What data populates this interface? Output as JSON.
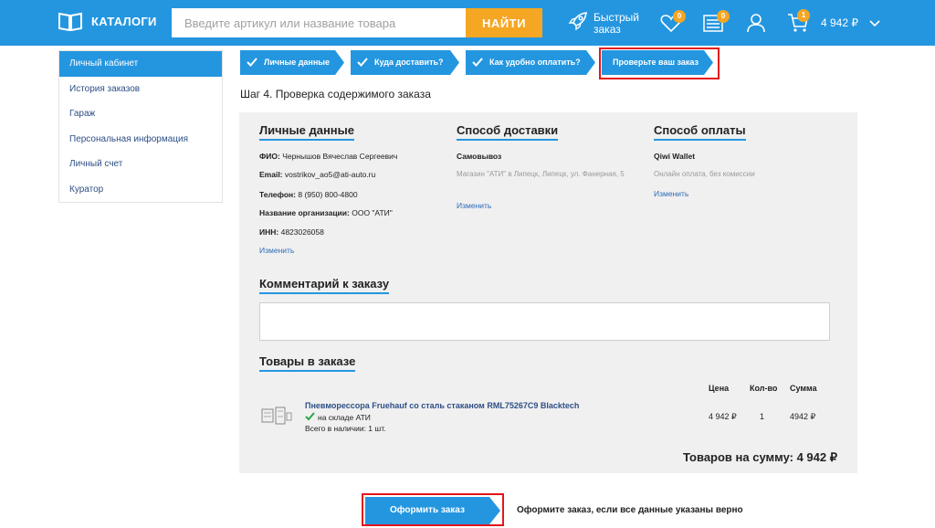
{
  "header": {
    "catalog_label": "КАТАЛОГИ",
    "search_placeholder": "Введите артикул или название товара",
    "search_button": "НАЙТИ",
    "quick_order_line1": "Быстрый",
    "quick_order_line2": "заказ",
    "favorites_count": "0",
    "compare_count": "0",
    "cart_count": "1",
    "cart_total": "4 942 ₽"
  },
  "sidebar": {
    "items": [
      {
        "label": "Личный кабинет",
        "active": true
      },
      {
        "label": "История заказов",
        "active": false
      },
      {
        "label": "Гараж",
        "active": false
      },
      {
        "label": "Персональная информация",
        "active": false
      },
      {
        "label": "Личный счет",
        "active": false
      },
      {
        "label": "Куратор",
        "active": false
      }
    ]
  },
  "steps": [
    {
      "label": "Личные данные",
      "done": true
    },
    {
      "label": "Куда доставить?",
      "done": true
    },
    {
      "label": "Как удобно оплатить?",
      "done": true
    },
    {
      "label": "Проверьте ваш заказ",
      "done": false
    }
  ],
  "step_title": "Шаг 4. Проверка содержимого заказа",
  "personal": {
    "heading": "Личные данные",
    "fio_label": "ФИО:",
    "fio": "Чернышов Вячеслав Сергеевич",
    "email_label": "Email:",
    "email": "vostrikov_ao5@ati-auto.ru",
    "phone_label": "Телефон:",
    "phone": "8 (950) 800-4800",
    "org_label": "Название организации:",
    "org": "ООО \"АТИ\"",
    "inn_label": "ИНН:",
    "inn": "4823026058",
    "edit": "Изменить"
  },
  "delivery": {
    "heading": "Способ доставки",
    "method": "Самовывоз",
    "address": "Магазин \"АТИ\" в Липецк, Липецк, ул. Фанерная, 5",
    "edit": "Изменить"
  },
  "payment": {
    "heading": "Способ оплаты",
    "method": "Qiwi Wallet",
    "note": "Онлайн оплата, без комиссии",
    "edit": "Изменить"
  },
  "comment_heading": "Комментарий к заказу",
  "goods": {
    "heading": "Товары в заказе",
    "col_price": "Цена",
    "col_qty": "Кол-во",
    "col_sum": "Сумма",
    "product_name": "Пневморессора Fruehauf со сталь стаканом  RML75267C9  Blacktech",
    "stock": "на складе АТИ",
    "availability": "Всего в наличии: 1 шт.",
    "price": "4 942 ₽",
    "qty": "1",
    "sum": "4942 ₽",
    "total": "Товаров на сумму: 4 942 ₽"
  },
  "order_button": "Оформить заказ",
  "order_hint": "Оформите заказ, если все данные указаны верно",
  "colors": {
    "accent": "#2496e0",
    "orange": "#f5a623",
    "highlight": "#e3161b"
  }
}
